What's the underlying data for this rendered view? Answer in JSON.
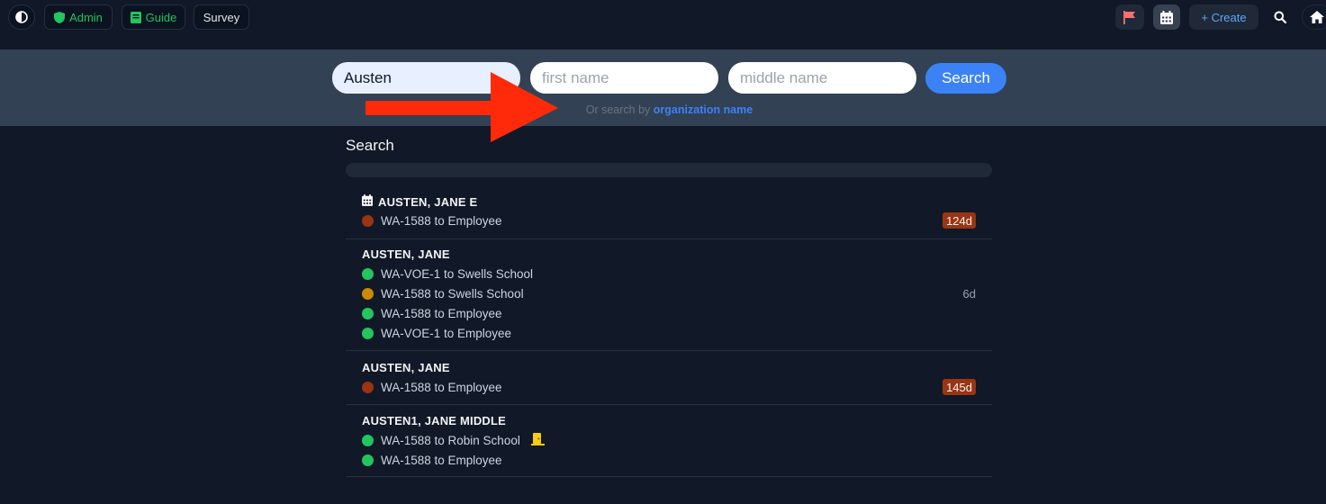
{
  "topbar": {
    "admin_label": "Admin",
    "guide_label": "Guide",
    "survey_label": "Survey",
    "create_label": "+ Create"
  },
  "search": {
    "last_name_value": "Austen",
    "first_name_placeholder": "first name",
    "middle_name_placeholder": "middle name",
    "button_label": "Search",
    "alt_text": "Or search by",
    "alt_link": "organization name"
  },
  "results": {
    "title": "Search",
    "people": [
      {
        "name": "AUSTEN, JANE E",
        "has_calendar_icon": true,
        "forms": [
          {
            "label": "WA-1588 to Employee",
            "status": "overdue"
          }
        ],
        "badge": "124d"
      },
      {
        "name": "AUSTEN, JANE",
        "forms": [
          {
            "label": "WA-VOE-1 to Swells School",
            "status": "complete"
          },
          {
            "label": "WA-1588 to Swells School",
            "status": "pending"
          },
          {
            "label": "WA-1588 to Employee",
            "status": "complete"
          },
          {
            "label": "WA-VOE-1 to Employee",
            "status": "complete"
          }
        ],
        "days": "6d"
      },
      {
        "name": "AUSTEN, JANE",
        "forms": [
          {
            "label": "WA-1588 to Employee",
            "status": "overdue"
          }
        ],
        "badge": "145d"
      },
      {
        "name": "AUSTEN1, JANE MIDDLE",
        "forms": [
          {
            "label": "WA-1588 to Robin School",
            "status": "complete",
            "icon": "door-icon"
          },
          {
            "label": "WA-1588 to Employee",
            "status": "complete"
          }
        ]
      }
    ]
  },
  "colors": {
    "background": "#111827",
    "band": "#334155",
    "accent": "#3b82f6",
    "status_complete": "#22c55e",
    "status_pending": "#ca8a04",
    "status_overdue": "#9a3412",
    "arrow": "#ff2a0a"
  }
}
